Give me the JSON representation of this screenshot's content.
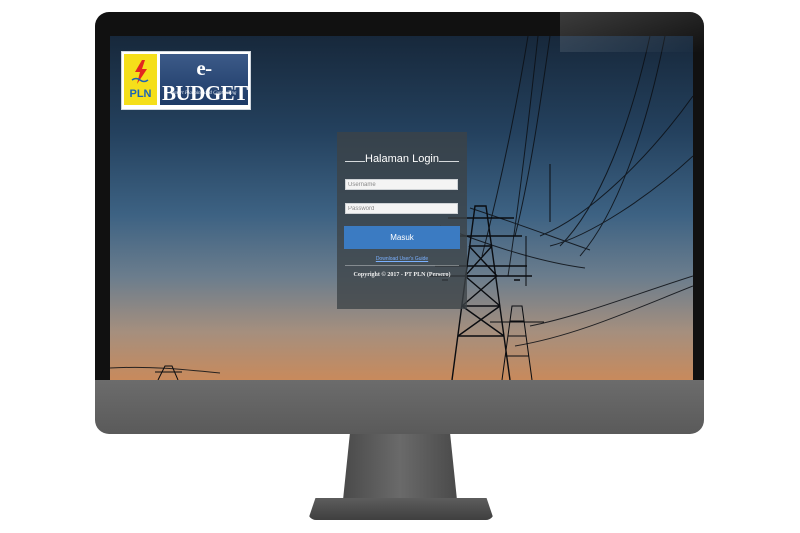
{
  "logo": {
    "company": "PLN",
    "title": "e-BUDGET",
    "tagline": "Smart Planning and Controlling",
    "brand_blue": "#1d3a66",
    "pln_yellow": "#f5df1a"
  },
  "login": {
    "title": "Halaman Login",
    "username_placeholder": "Username",
    "password_placeholder": "Password",
    "submit_label": "Masuk",
    "download_link": "Download User's Guide",
    "copyright": "Copyright © 2017 - PT PLN (Persero)",
    "button_color": "#3b7bc2"
  },
  "icons": {
    "logo_mark": "lightning-bolt-icon"
  }
}
